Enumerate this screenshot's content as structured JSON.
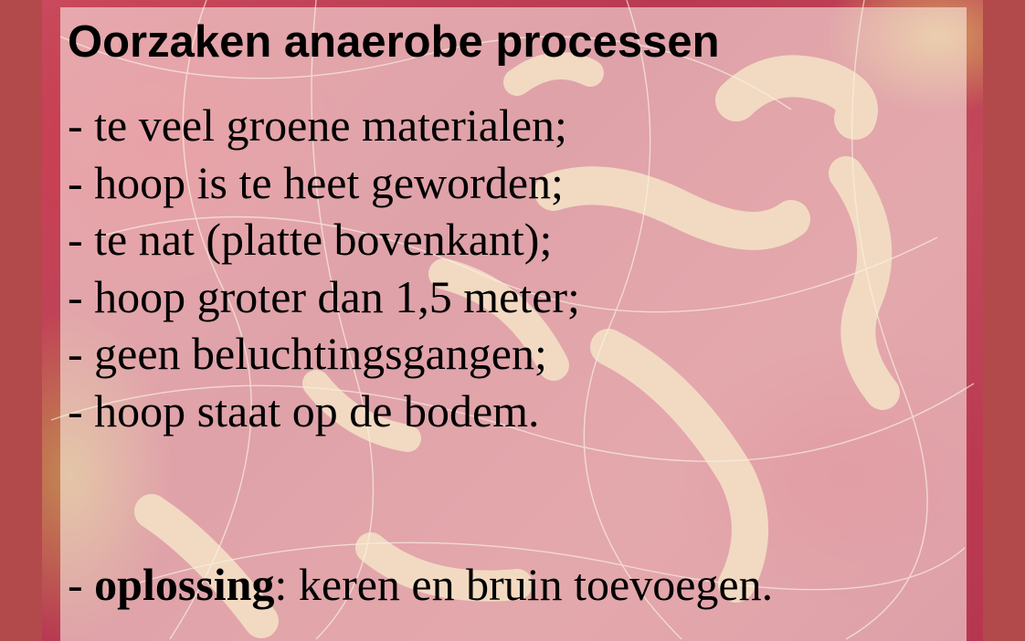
{
  "slide": {
    "title": "Oorzaken anaerobe processen",
    "dash": "- ",
    "causes": [
      "te veel groene materialen;",
      "hoop is te heet geworden;",
      "te nat (platte bovenkant);",
      "hoop groter dan 1,5 meter;",
      "geen beluchtingsgangen;",
      "hoop staat op de bodem."
    ],
    "solution": {
      "label": "oplossing",
      "text": ": keren en bruin toevoegen."
    }
  },
  "colors": {
    "border": "#b24a4c",
    "background_tint": "#c84a5c",
    "bacteria": "#e8c690"
  }
}
